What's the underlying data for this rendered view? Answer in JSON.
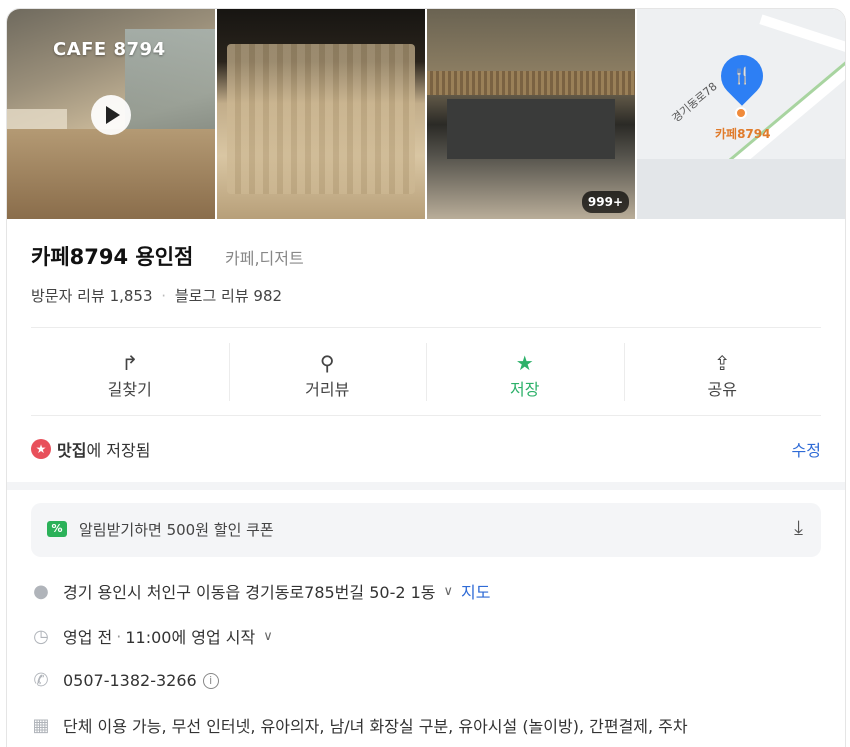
{
  "photos": {
    "cafe_title": "CAFE 8794",
    "photo_count_badge": "999+",
    "map_road_label": "경기동로78",
    "map_place_label": "카페8794"
  },
  "place": {
    "name": "카페8794 용인점",
    "category": "카페,디저트",
    "visitor_review_label": "방문자 리뷰",
    "visitor_review_count": "1,853",
    "blog_review_label": "블로그 리뷰",
    "blog_review_count": "982"
  },
  "actions": [
    {
      "label": "길찾기",
      "icon": "directions-icon"
    },
    {
      "label": "거리뷰",
      "icon": "street-view-icon"
    },
    {
      "label": "저장",
      "icon": "star-icon",
      "accent": "#2db16a"
    },
    {
      "label": "공유",
      "icon": "share-icon"
    }
  ],
  "saved": {
    "list_name": "맛집",
    "suffix": "에 저장됨",
    "edit_label": "수정"
  },
  "coupon": {
    "text": "알림받기하면 500원 할인 쿠폰"
  },
  "details": {
    "address": "경기 용인시 처인구 이동읍 경기동로785번길 50-2 1동",
    "map_link": "지도",
    "hours_status": "영업 전",
    "hours_detail": "11:00에 영업 시작",
    "phone": "0507-1382-3266",
    "amenities": "단체 이용 가능, 무선 인터넷, 유아의자, 남/녀 화장실 구분, 유아시설 (놀이방), 간편결제, 주차"
  },
  "colors": {
    "accent_green": "#2db16a",
    "link_blue": "#2f6bd6",
    "pin_blue": "#2d7ff4",
    "saved_red": "#e8505b"
  }
}
